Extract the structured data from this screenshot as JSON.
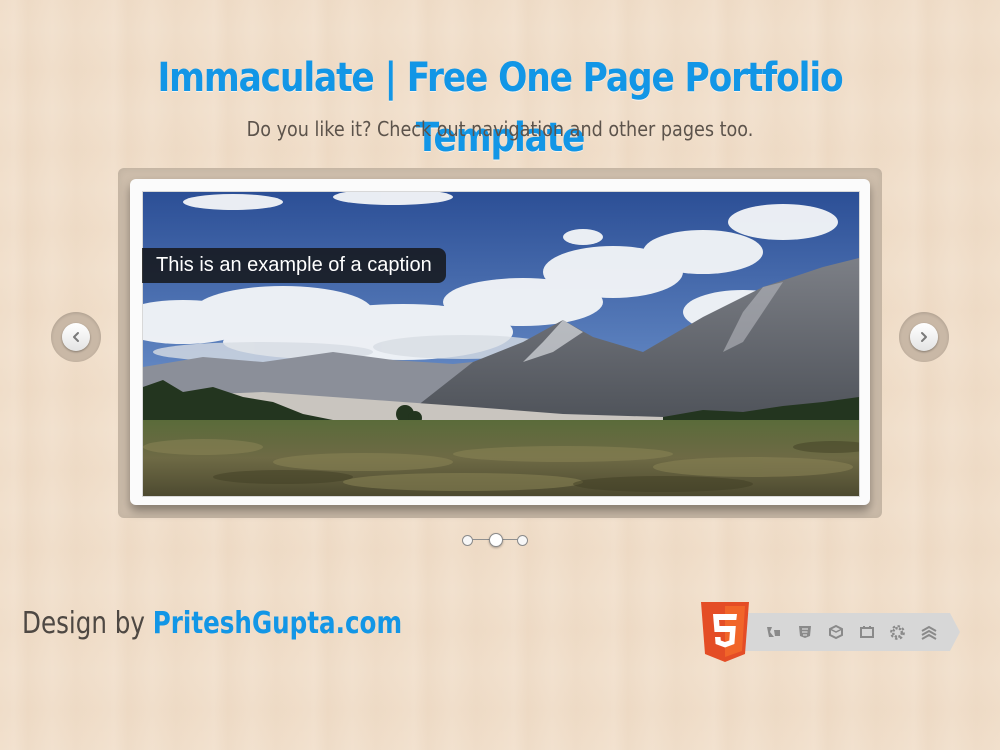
{
  "header": {
    "title": "Immaculate | Free One Page Portfolio Template",
    "subtitle": "Do you like it? Check out navigation and other pages too."
  },
  "slider": {
    "caption": "This is an example of a caption",
    "slide_count": 3,
    "active_slide": 2
  },
  "footer": {
    "credit_prefix": "Design by ",
    "credit_link": "PriteshGupta.com",
    "badge_icons": [
      "html5-logo",
      "semantics-icon",
      "css3-icon",
      "3d-effects-icon",
      "multimedia-icon",
      "performance-gear-icon",
      "connectivity-icon"
    ]
  },
  "colors": {
    "accent": "#1296e6",
    "background": "#f1dfcb",
    "html5_orange": "#e44d26"
  }
}
